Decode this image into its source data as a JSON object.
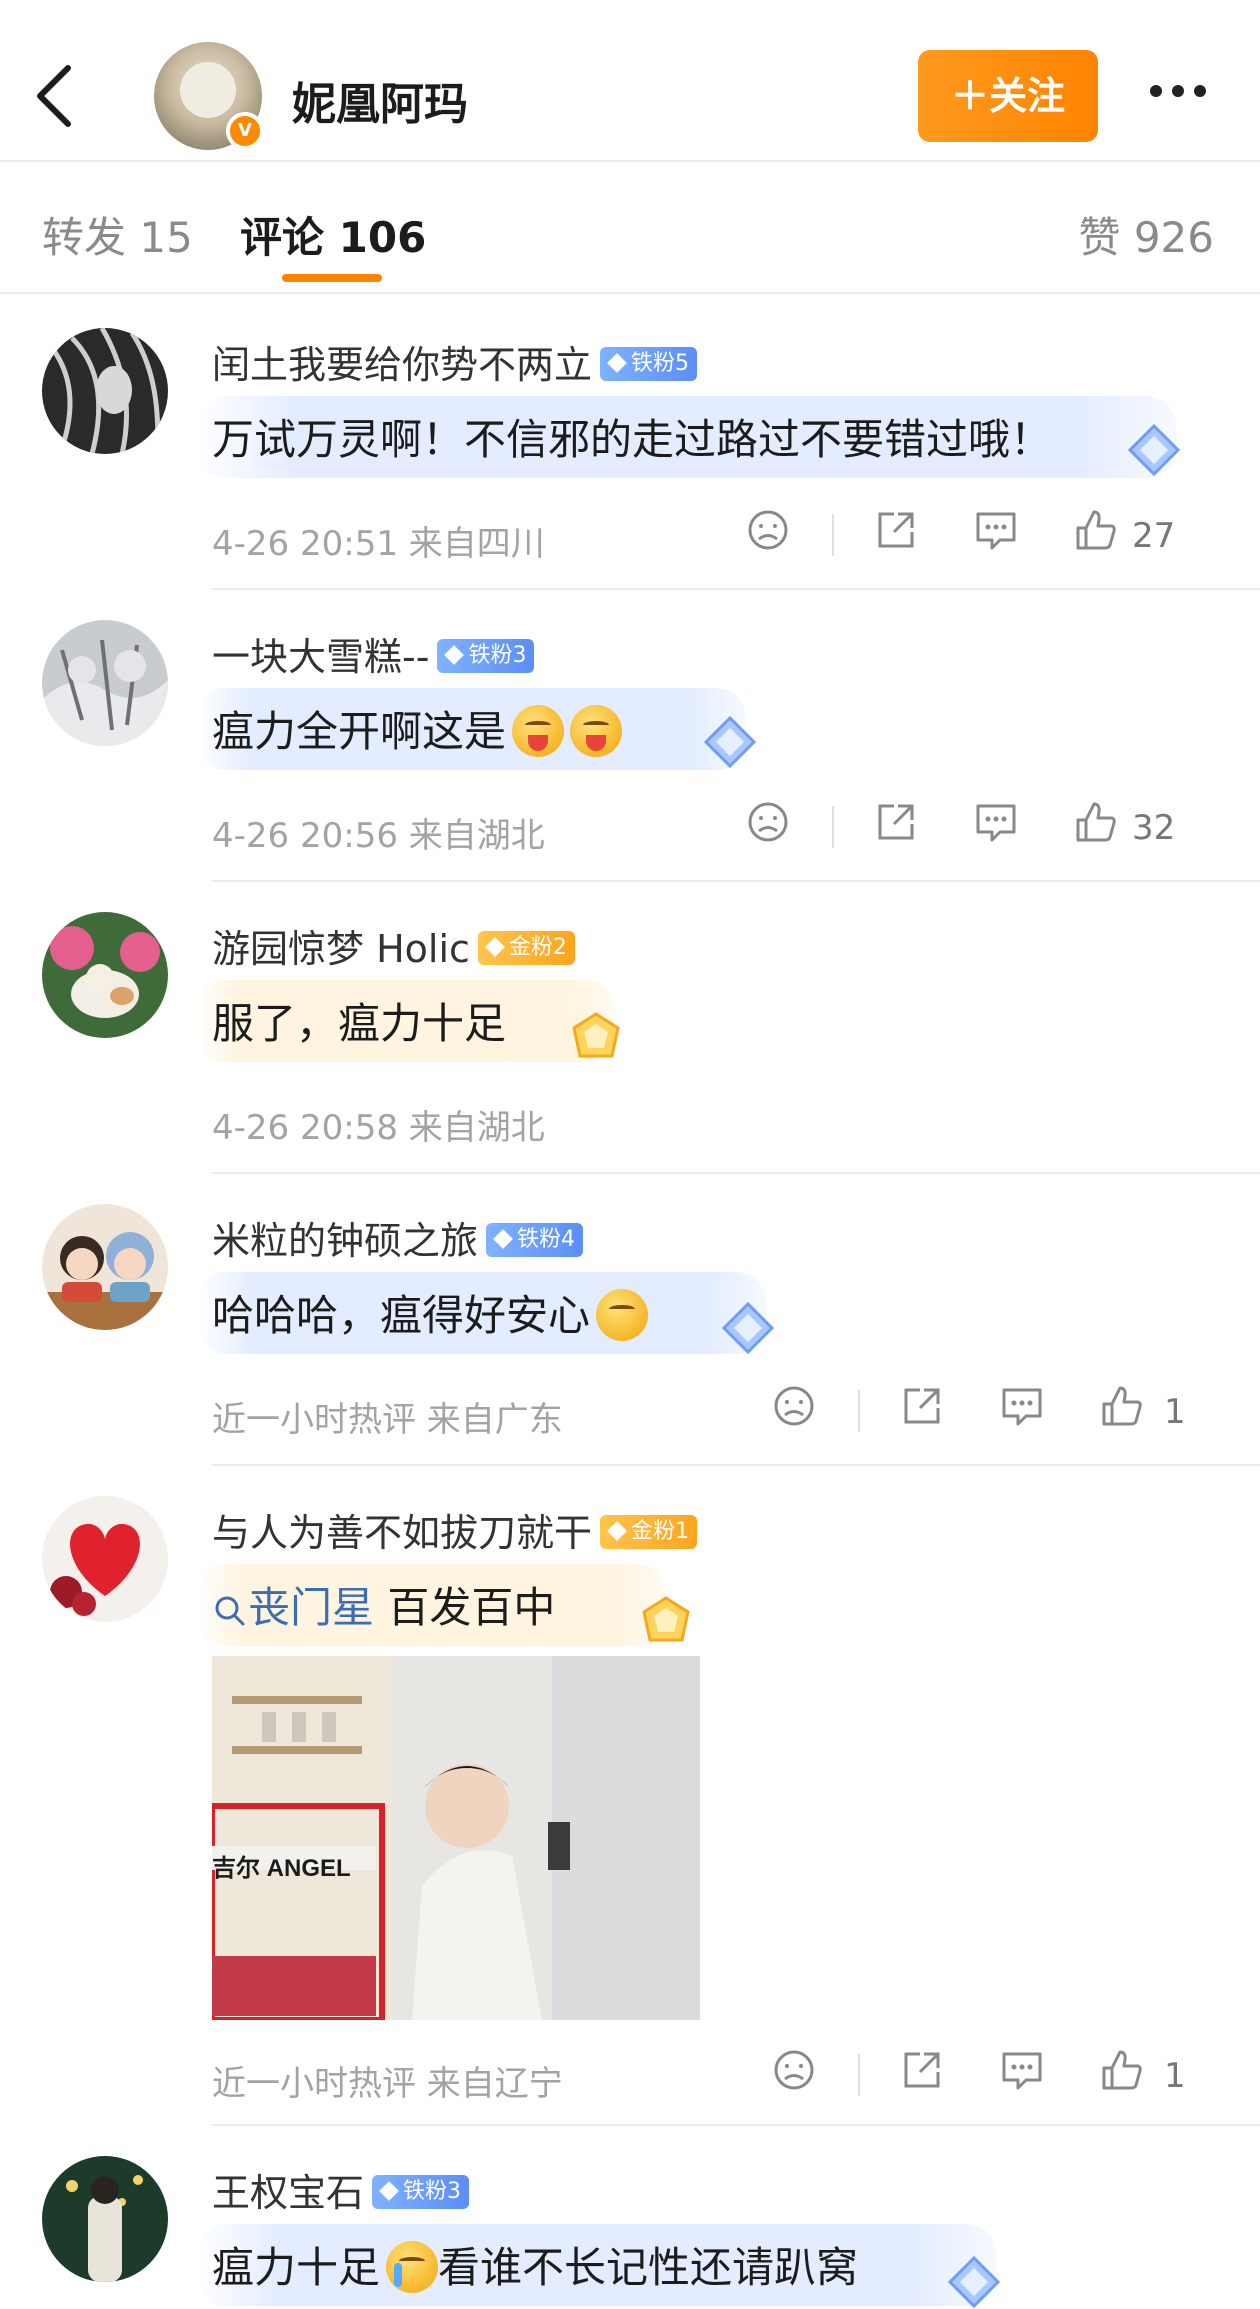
{
  "header": {
    "name": "妮凰阿玛",
    "follow_label": "＋关注"
  },
  "tabs": {
    "repost": "转发 15",
    "comment": "评论 106",
    "like": "赞 926"
  },
  "comments": [
    {
      "user": "闰土我要给你势不两立",
      "badge": "铁粉5",
      "text": "万试万灵啊！不信邪的走过路过不要错过哦！",
      "meta": "4-26 20:51 来自四川",
      "likes": "27"
    },
    {
      "user": "一块大雪糕--",
      "badge": "铁粉3",
      "text": "瘟力全开啊这是",
      "meta": "4-26 20:56 来自湖北",
      "likes": "32"
    },
    {
      "user": "游园惊梦 Holic",
      "badge": "金粉2",
      "text": "服了，瘟力十足",
      "meta": "4-26 20:58 来自湖北",
      "likes": ""
    },
    {
      "user": "米粒的钟硕之旅",
      "badge": "铁粉4",
      "text": "哈哈哈，瘟得好安心",
      "meta": "近一小时热评  来自广东",
      "likes": "1"
    },
    {
      "user": "与人为善不如拔刀就干",
      "badge": "金粉1",
      "mention": "丧门星",
      "text": " 百发百中",
      "image_caption": "吉尔 ANGEL",
      "meta": "近一小时热评  来自辽宁",
      "likes": "1"
    },
    {
      "user": "王权宝石",
      "badge": "铁粉3",
      "text_before": "瘟力十足",
      "text_after": "看谁不长记性还请趴窝"
    }
  ],
  "colors": {
    "accent_orange": "#ff8400",
    "iron_badge": "#5b8ef7",
    "gold_badge": "#ffa41e",
    "meta_gray": "#a3a3a3"
  },
  "icons": [
    "back-arrow-icon",
    "verified-icon",
    "more-dots-icon",
    "dislike-icon",
    "share-icon",
    "comment-icon",
    "like-icon",
    "search-icon",
    "diamond-icon"
  ]
}
